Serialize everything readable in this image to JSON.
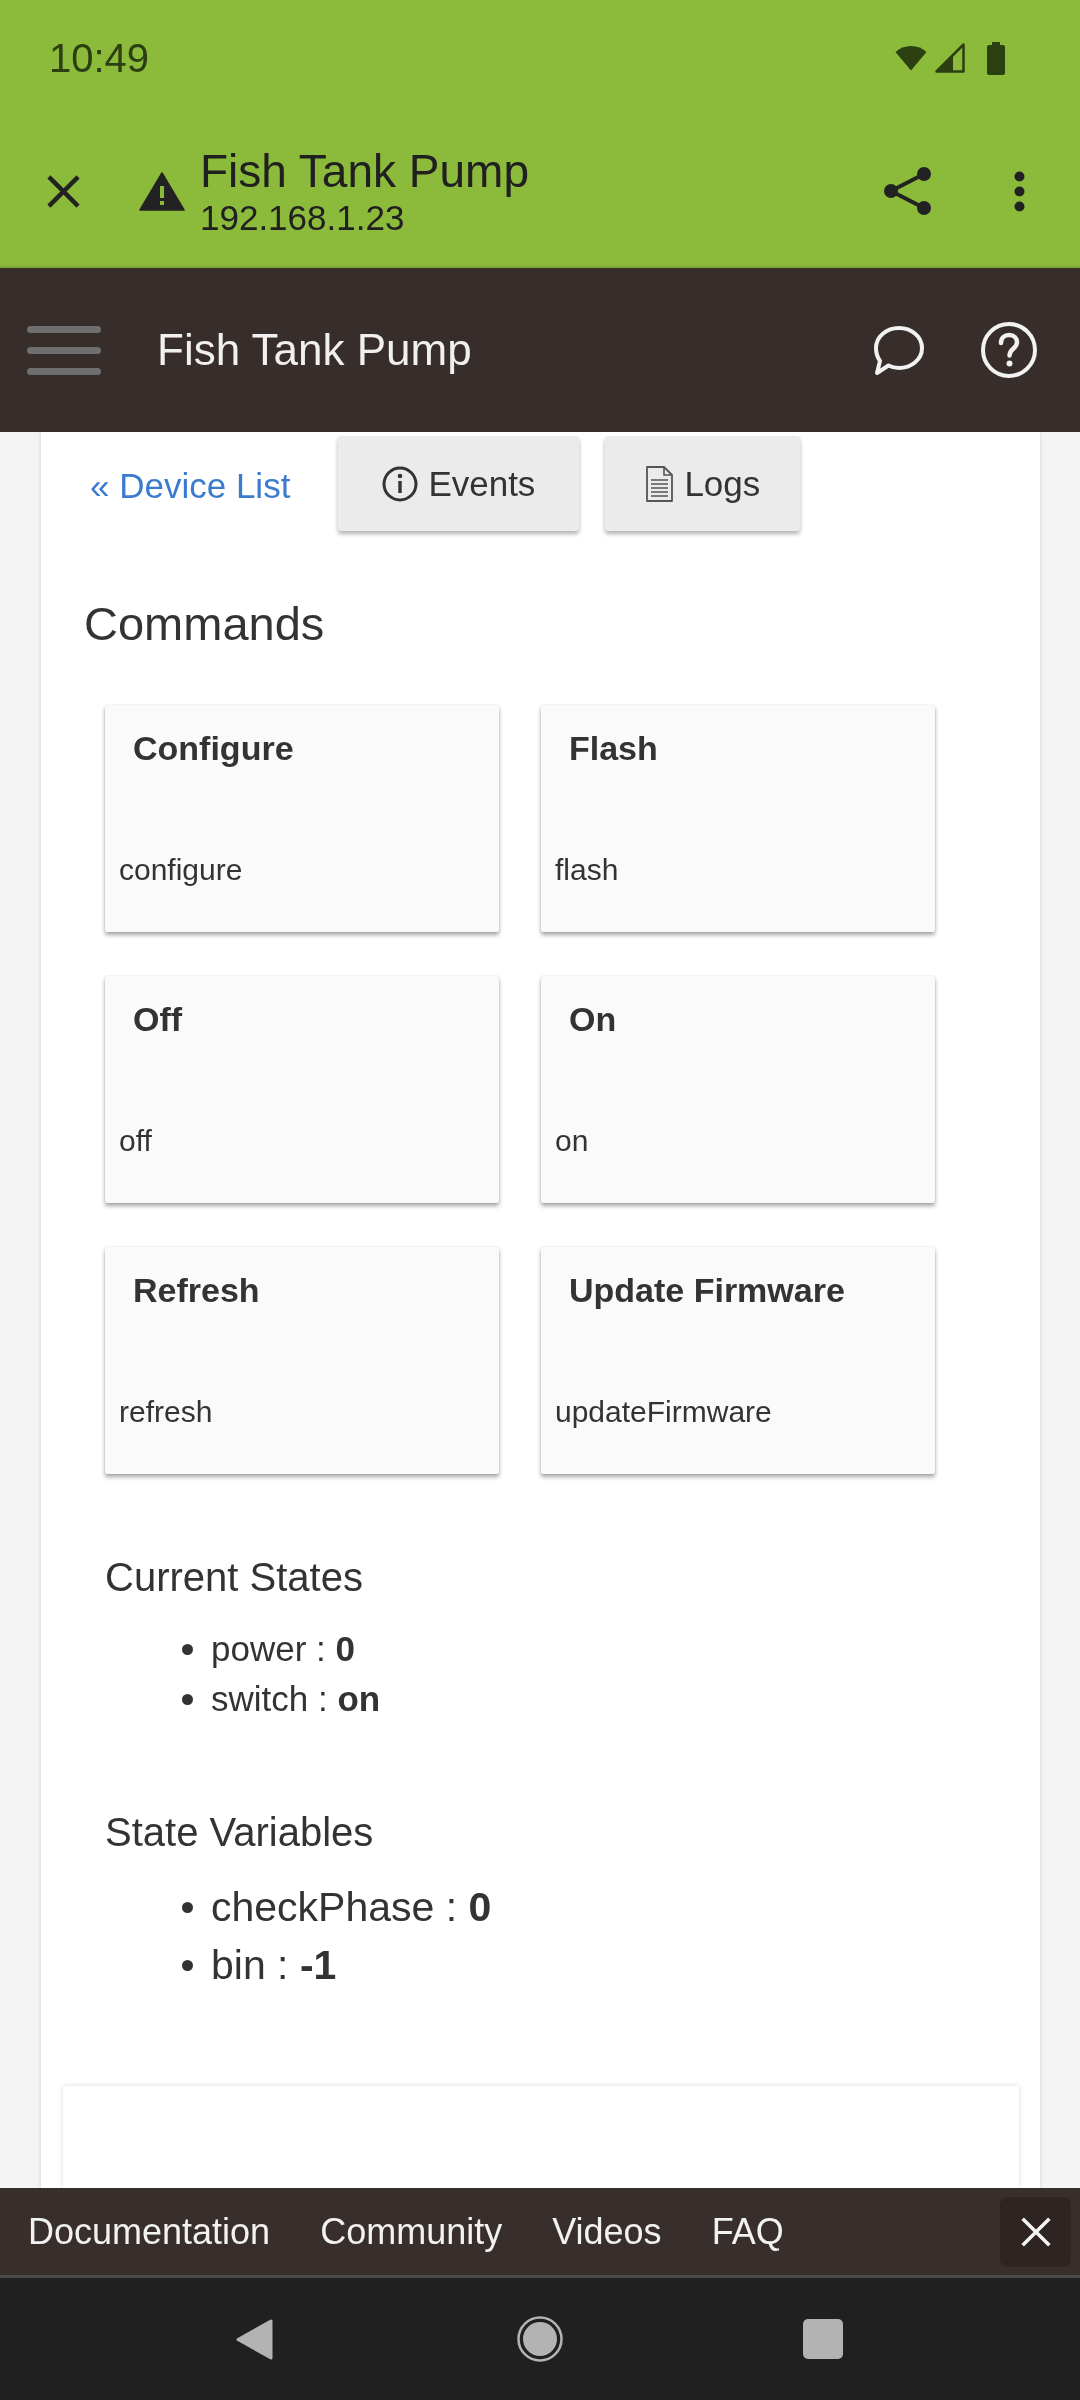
{
  "status_bar": {
    "time": "10:49"
  },
  "browser_bar": {
    "title": "Fish Tank Pump",
    "url": "192.168.1.23"
  },
  "app_bar": {
    "title": "Fish Tank Pump"
  },
  "device_nav": {
    "back_link": "« Device List",
    "buttons": [
      {
        "kind": "events",
        "label": "Events"
      },
      {
        "kind": "logs",
        "label": "Logs"
      }
    ]
  },
  "commands": {
    "heading": "Commands",
    "items": [
      {
        "title": "Configure",
        "command": "configure"
      },
      {
        "title": "Flash",
        "command": "flash"
      },
      {
        "title": "Off",
        "command": "off"
      },
      {
        "title": "On",
        "command": "on"
      },
      {
        "title": "Refresh",
        "command": "refresh"
      },
      {
        "title": "Update Firmware",
        "command": "updateFirmware"
      }
    ]
  },
  "current_states": {
    "heading": "Current States",
    "items": [
      "power : **0**",
      "switch : **on**"
    ]
  },
  "state_variables": {
    "heading": "State Variables",
    "items": [
      "checkPhase : **0**",
      "bin : **-1**"
    ]
  },
  "footer": {
    "links": [
      "Documentation",
      "Community",
      "Videos",
      "FAQ"
    ]
  }
}
